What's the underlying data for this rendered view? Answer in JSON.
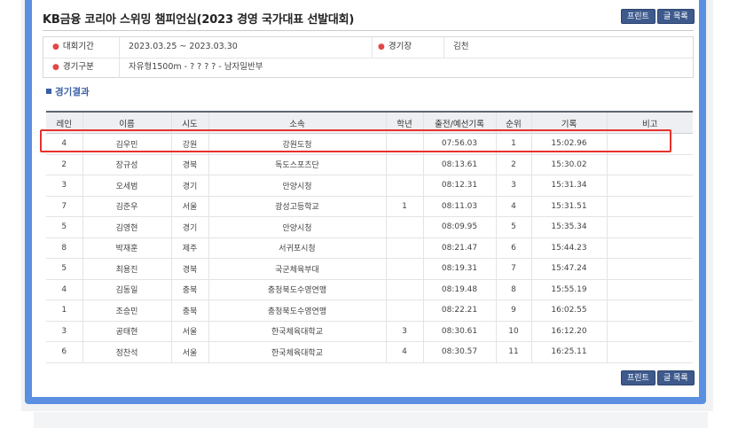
{
  "header": {
    "title": "KB금융 코리아 스위밍 챔피언십(2023 경영 국가대표 선발대회)",
    "print_label": "프린트",
    "list_label": "글 목록"
  },
  "info": {
    "period_label": "대회기간",
    "period_value": "2023.03.25 ~ 2023.03.30",
    "venue_label": "경기장",
    "venue_value": "김천",
    "event_label": "경기구분",
    "event_value": "자유형1500m - ? ? ? ?  - 남자일반부"
  },
  "section": {
    "title": "경기결과"
  },
  "table": {
    "headers": [
      "레인",
      "이름",
      "시도",
      "소속",
      "학년",
      "출전/예선기록",
      "순위",
      "기록",
      "비고"
    ],
    "rows": [
      [
        "4",
        "김우민",
        "강원",
        "강원도청",
        "",
        "07:56.03",
        "1",
        "15:02.96",
        ""
      ],
      [
        "2",
        "장규성",
        "경북",
        "독도스포츠단",
        "",
        "08:13.61",
        "2",
        "15:30.02",
        ""
      ],
      [
        "3",
        "오세범",
        "경기",
        "안양시청",
        "",
        "08:12.31",
        "3",
        "15:31.34",
        ""
      ],
      [
        "7",
        "김준우",
        "서울",
        "광성고등학교",
        "1",
        "08:11.03",
        "4",
        "15:31.51",
        ""
      ],
      [
        "5",
        "김영현",
        "경기",
        "안양시청",
        "",
        "08:09.95",
        "5",
        "15:35.34",
        ""
      ],
      [
        "8",
        "박재훈",
        "제주",
        "서귀포시청",
        "",
        "08:21.47",
        "6",
        "15:44.23",
        ""
      ],
      [
        "5",
        "최용진",
        "경북",
        "국군체육부대",
        "",
        "08:19.31",
        "7",
        "15:47.24",
        ""
      ],
      [
        "4",
        "김동일",
        "충북",
        "충청북도수영연맹",
        "",
        "08:19.48",
        "8",
        "15:55.19",
        ""
      ],
      [
        "1",
        "조승민",
        "충북",
        "충청북도수영연맹",
        "",
        "08:22.21",
        "9",
        "16:02.55",
        ""
      ],
      [
        "3",
        "공태현",
        "서울",
        "한국체육대학교",
        "3",
        "08:30.61",
        "10",
        "16:12.20",
        ""
      ],
      [
        "6",
        "정찬석",
        "서울",
        "한국체육대학교",
        "4",
        "08:30.57",
        "11",
        "16:25.11",
        ""
      ]
    ]
  },
  "footer": {
    "print_label": "프린트",
    "list_label": "글 목록"
  },
  "colors": {
    "frame_blue": "#5b8fe0",
    "button_navy": "#3e5a8c",
    "highlight_red": "#e8312a",
    "section_blue": "#3b5ea8"
  }
}
